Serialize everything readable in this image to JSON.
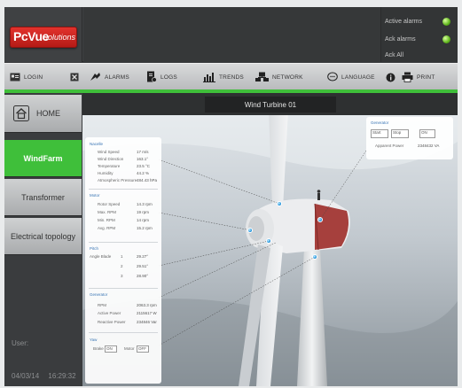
{
  "header": {
    "logo_main": "PcVue",
    "logo_sub": "Solutions",
    "alarm_panel": {
      "active_alarms": "Active alarms",
      "ack_alarms": "Ack alarms",
      "ack_all": "Ack All"
    }
  },
  "toolbar": {
    "login": "LOGIN",
    "alarms": "ALARMS",
    "logs": "LOGS",
    "trends": "TRENDS",
    "network": "NETWORK",
    "language": "LANGUAGE",
    "print": "PRINT"
  },
  "sidebar": {
    "home": "HOME",
    "items": [
      "WindFarm",
      "Transformer",
      "Electrical topology"
    ],
    "active_item": "WindFarm",
    "user_label": "User:",
    "date": "04/03/14",
    "time": "16:29:32"
  },
  "main": {
    "title": "Wind Turbine 01",
    "nacelle": {
      "title": "Nacelle",
      "rows": [
        {
          "label": "Wind Speed",
          "value": "17 m/s"
        },
        {
          "label": "Wind Direction",
          "value": "163.1°"
        },
        {
          "label": "Temperature",
          "value": "23.5 °C"
        },
        {
          "label": "Humidity",
          "value": "44.2 %"
        },
        {
          "label": "Atmospheric Pressure",
          "value": "484.43 hPa"
        }
      ]
    },
    "motor": {
      "title": "Motor",
      "rows": [
        {
          "label": "Rotor Speed",
          "value": "14.3 rpm"
        },
        {
          "label": "Max. RPM",
          "value": "19 rpm"
        },
        {
          "label": "Min. RPM",
          "value": "14 rpm"
        },
        {
          "label": "Avg. RPM",
          "value": "15.2 rpm"
        }
      ]
    },
    "pitch": {
      "title": "Pitch",
      "label": "Angle Blade",
      "rows": [
        {
          "index": "1",
          "value": "29.27°"
        },
        {
          "index": "2",
          "value": "29.51°"
        },
        {
          "index": "3",
          "value": "28.90°"
        }
      ]
    },
    "generator_left": {
      "title": "Generator",
      "rows": [
        {
          "label": "RPM",
          "value": "2063.3 rpm"
        },
        {
          "label": "Active Power",
          "value": "2115617 W"
        },
        {
          "label": "Reactive Power",
          "value": "234846 Var"
        }
      ]
    },
    "yaw": {
      "title": "Yaw",
      "brake_label": "Brake",
      "brake_value": "ON",
      "motor_label": "Motor",
      "motor_value": "OFF"
    },
    "generator_right": {
      "title": "Generator",
      "start": "Start",
      "stop": "Stop",
      "state": "ON",
      "apparent_power_label": "Apparent Power",
      "apparent_power_value": "2348432 VA"
    }
  },
  "colors": {
    "accent_green": "#3fbf3a",
    "logo_red": "#d6261f",
    "section_blue": "#3a76b5",
    "marker_blue": "#2b9be0"
  }
}
